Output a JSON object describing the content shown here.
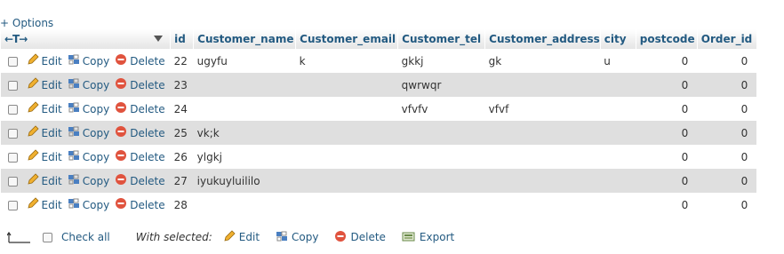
{
  "options_link": "+ Options",
  "header": {
    "nav_arrows": "←T→",
    "columns": [
      "id",
      "Customer_name",
      "Customer_email",
      "Customer_tel",
      "Customer_address",
      "city",
      "postcode",
      "Order_id"
    ]
  },
  "actions": {
    "edit": "Edit",
    "copy": "Copy",
    "delete": "Delete"
  },
  "rows": [
    {
      "id": "22",
      "Customer_name": "ugyfu",
      "Customer_email": "k",
      "Customer_tel": "gkkj",
      "Customer_address": "gk",
      "city": "u",
      "postcode": "0",
      "Order_id": "0"
    },
    {
      "id": "23",
      "Customer_name": "",
      "Customer_email": "",
      "Customer_tel": "qwrwqr",
      "Customer_address": "",
      "city": "",
      "postcode": "0",
      "Order_id": "0"
    },
    {
      "id": "24",
      "Customer_name": "",
      "Customer_email": "",
      "Customer_tel": "vfvfv",
      "Customer_address": "vfvf",
      "city": "",
      "postcode": "0",
      "Order_id": "0"
    },
    {
      "id": "25",
      "Customer_name": "vk;k",
      "Customer_email": "",
      "Customer_tel": "",
      "Customer_address": "",
      "city": "",
      "postcode": "0",
      "Order_id": "0"
    },
    {
      "id": "26",
      "Customer_name": "ylgkj",
      "Customer_email": "",
      "Customer_tel": "",
      "Customer_address": "",
      "city": "",
      "postcode": "0",
      "Order_id": "0"
    },
    {
      "id": "27",
      "Customer_name": "iyukuyluililo",
      "Customer_email": "",
      "Customer_tel": "",
      "Customer_address": "",
      "city": "",
      "postcode": "0",
      "Order_id": "0"
    },
    {
      "id": "28",
      "Customer_name": "",
      "Customer_email": "",
      "Customer_tel": "",
      "Customer_address": "",
      "city": "",
      "postcode": "0",
      "Order_id": "0"
    }
  ],
  "footer": {
    "check_all": "Check all",
    "with_selected": "With selected:",
    "edit": "Edit",
    "copy": "Copy",
    "delete": "Delete",
    "export": "Export"
  },
  "colors": {
    "link": "#235a81",
    "row_alt": "#dfdfdf",
    "delete_icon": "#e0533e",
    "edit_icon": "#e8a317"
  }
}
